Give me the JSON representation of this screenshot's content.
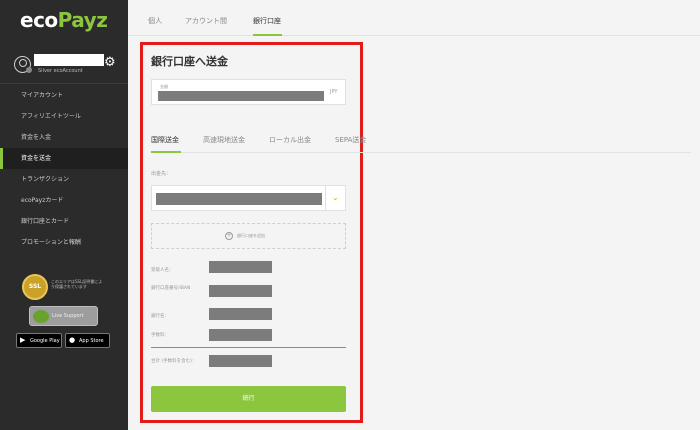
{
  "brand": {
    "logo_main": "eco",
    "logo_accent": "Payz"
  },
  "profile": {
    "account_type": "Silver ecoAccount"
  },
  "sidebar": {
    "items": [
      {
        "label": "マイアカウント",
        "active": false
      },
      {
        "label": "アフィリエイトツール",
        "active": false
      },
      {
        "label": "資金を入金",
        "active": false
      },
      {
        "label": "資金を送金",
        "active": true
      },
      {
        "label": "トランザクション",
        "active": false
      },
      {
        "label": "ecoPayzカード",
        "active": false
      },
      {
        "label": "銀行口座とカード",
        "active": false
      },
      {
        "label": "プロモーションと報酬",
        "active": false
      }
    ],
    "ssl": {
      "seal": "SSL",
      "text": "このエリアはSSL証明書により保護されています"
    },
    "live_support": "Live Support",
    "google_play": "Google Play",
    "app_store": "App Store"
  },
  "top_tabs": [
    "個人",
    "アカウント間",
    "銀行口座"
  ],
  "panel": {
    "title": "銀行口座へ送金",
    "amount_label": "金額",
    "currency": "JPY",
    "sub_tabs": [
      "国際送金",
      "高速現地送金",
      "ローカル出金",
      "SEPA送金"
    ],
    "destination_label": "出金先：",
    "add_bank_label": "銀行口座を追加",
    "info": {
      "beneficiary": "受取人名：",
      "account_iban": "銀行口座番号/IBAN",
      "bank_name": "銀行名：",
      "fee": "手数料：",
      "total": "合計 (手数料を含む)："
    },
    "continue_label": "続行"
  },
  "colors": {
    "accent": "#8cc63f",
    "highlight_border": "#e21b1b",
    "sidebar_bg": "#2b2b2b"
  }
}
